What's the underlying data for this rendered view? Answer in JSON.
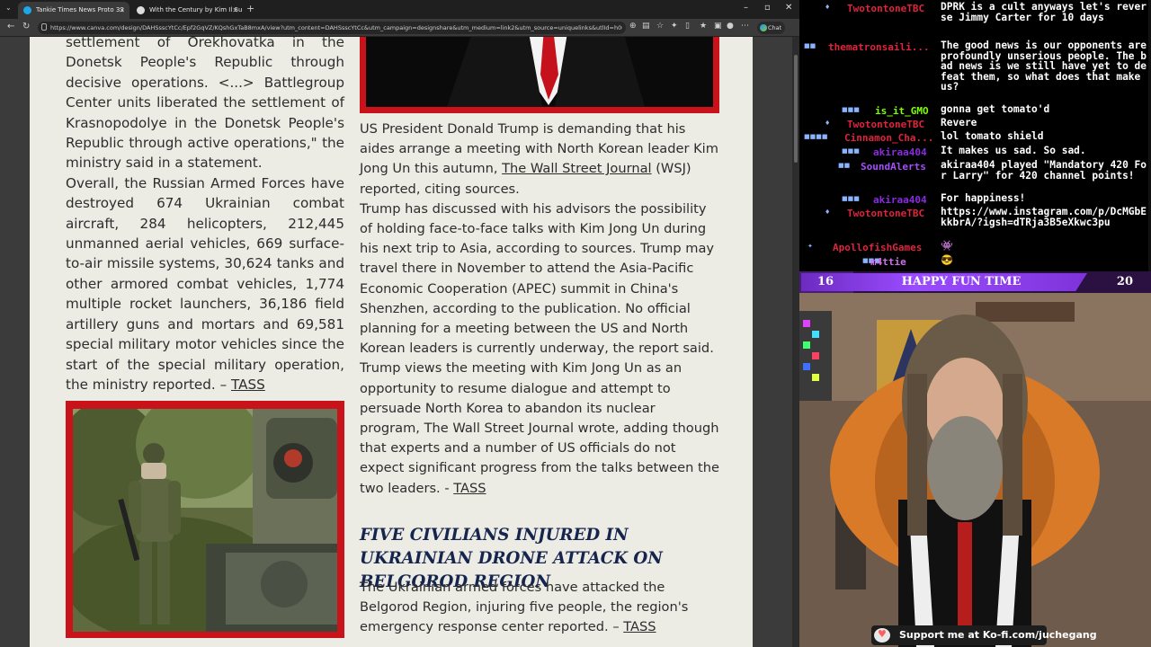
{
  "browser": {
    "tabs": [
      {
        "title": "Tankie Times News Proto 33",
        "favicon_color": "#1ea7e8",
        "active": true
      },
      {
        "title": "With the Century by Kim Il Sung",
        "favicon_color": "#ddd",
        "active": false
      }
    ],
    "new_tab_label": "+",
    "url": "https://www.canva.com/design/DAHSsscYtCc/Epf2GqVZ/KQshGxTaB8mxA/view?utm_content=DAHSsscYtCc&utm_campaign=designshare&utm_medium=link2&utm_source=uniquelinks&utlId=h00...",
    "chat_button_label": "Chat"
  },
  "article": {
    "col1_text_1": "settlement of Orekhovatka in the Donetsk People's Republic through decisive operations. <...> Battlegroup Center units liberated the settlement of Krasnopodolye in the Donetsk People's Republic through active operations,\" the ministry said in a statement.",
    "col1_text_2": "Overall, the Russian Armed Forces have destroyed 674 Ukrainian combat aircraft, 284 helicopters, 212,445 unmanned aerial vehicles, 669 surface-to-air missile systems, 30,624 tanks and other armored combat vehicles, 1,774 multiple rocket launchers, 36,186 field artillery guns and mortars and 69,581 special military motor vehicles since the start of the special military operation, the ministry reported. – ",
    "col1_source": "TASS",
    "trump_p1_a": "US President Donald Trump is demanding that his aides arrange a meeting with North Korean leader Kim Jong Un this autumn, ",
    "trump_p1_link": "The Wall Street Journal",
    "trump_p1_b": " (WSJ) reported, citing sources.",
    "trump_p2": "Trump has discussed with his advisors the possibility of holding face-to-face talks with Kim Jong Un during his next trip to Asia, according to sources. Trump may travel there in November to attend the Asia-Pacific Economic Cooperation (APEC) summit in China's Shenzhen, according to the publication. No official planning for a meeting between the US and North Korean leaders is currently underway, the report said.",
    "trump_p3": "Trump views the meeting with Kim Jong Un as an opportunity to resume dialogue and attempt to persuade North Korea to abandon its nuclear program, The Wall Street Journal wrote, adding though that experts and a number of US officials do not expect significant progress from the talks between the two leaders. - ",
    "trump_p3_source": "TASS",
    "headline": "Five civilians injured in Ukrainian drone attack on Belgorod region",
    "belgorod_text": "The Ukrainian armed forces have attacked the Belgorod Region, injuring five people, the region's emergency response center reported. – ",
    "belgorod_source": "TASS",
    "frame_color": "#c8131a"
  },
  "chat": {
    "messages": [
      {
        "user": "TwotontoneTBC",
        "color": "#e0243c",
        "icons": "♦",
        "text": "DPRK is a cult anyways let's reverse Jimmy Carter for 10 days"
      },
      {
        "user": "thematronsaili...",
        "color": "#e0243c",
        "icons": "■■",
        "text": "The good news is our opponents are profoundly unserious people. The bad news is we still have yet to defeat them, so what does that make us?"
      },
      {
        "user": "is_it_GMO",
        "color": "#7fff00",
        "icons": "■■■",
        "text": "gonna get tomato'd"
      },
      {
        "user": "TwotontoneTBC",
        "color": "#e0243c",
        "icons": "♦",
        "text": "Revere"
      },
      {
        "user": "Cinnamon_Cha...",
        "color": "#e0243c",
        "icons": "■■■■",
        "text": "lol tomato shield"
      },
      {
        "user": "akiraa404",
        "color": "#8a2be2",
        "icons": "■■■",
        "text": "It makes us sad. So sad."
      },
      {
        "user": "SoundAlerts",
        "color": "#a64dff",
        "icons": "■■",
        "text": "akiraa404 played \"Mandatory 420 For Larry\" for 420 channel points!"
      },
      {
        "user": "akiraa404",
        "color": "#8a2be2",
        "icons": "■■■",
        "text": "For happiness!"
      },
      {
        "user": "TwotontoneTBC",
        "color": "#e0243c",
        "icons": "♦",
        "text": "https://www.instagram.com/p/DcMGbEkkbrA/?igsh=dTRja3B5eXkwc3pu"
      },
      {
        "user": "ApollofishGames",
        "color": "#e0243c",
        "icons": "✦",
        "text": "👾"
      },
      {
        "user": "m4ttie",
        "color": "#d06ee8",
        "icons": "■■■",
        "text": "😎"
      }
    ]
  },
  "overlay": {
    "left_number": "16",
    "title": "HAPPY FUN TIME",
    "right_number": "20"
  },
  "kofi": {
    "text": "Support me at Ko-fi.com/juchegang"
  }
}
